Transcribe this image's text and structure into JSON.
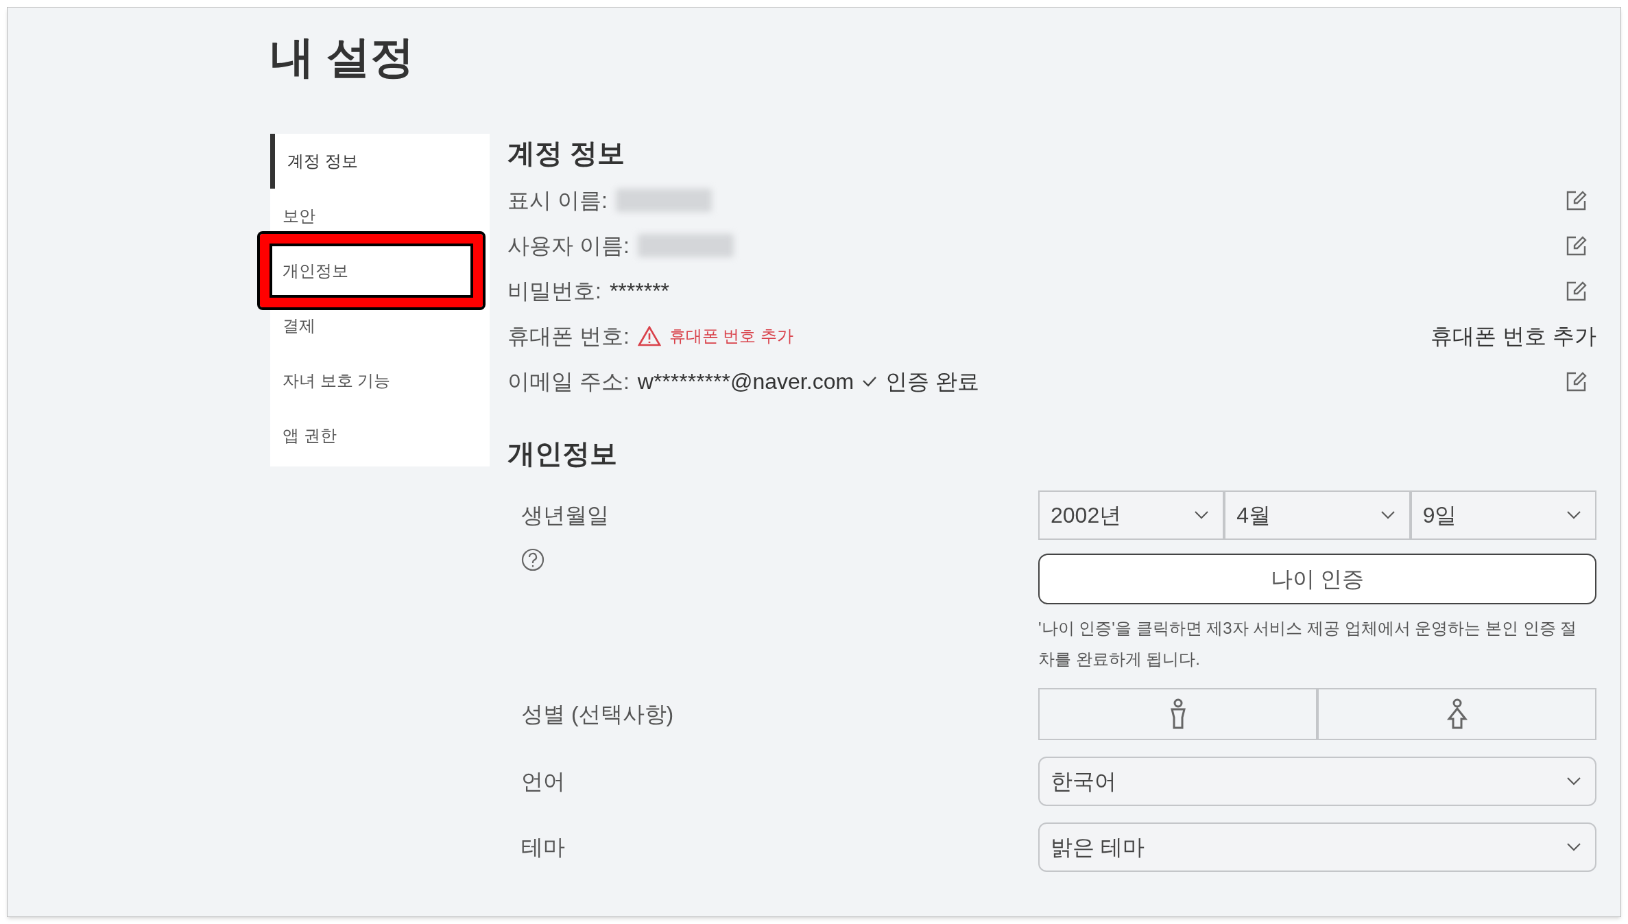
{
  "page": {
    "title": "내 설정"
  },
  "sidebar": {
    "items": [
      {
        "label": "계정 정보",
        "selected": true,
        "highlighted": false
      },
      {
        "label": "보안",
        "selected": false,
        "highlighted": false
      },
      {
        "label": "개인정보",
        "selected": false,
        "highlighted": true
      },
      {
        "label": "결제",
        "selected": false,
        "highlighted": false
      },
      {
        "label": "자녀 보호 기능",
        "selected": false,
        "highlighted": false
      },
      {
        "label": "앱 권한",
        "selected": false,
        "highlighted": false
      }
    ]
  },
  "account_info": {
    "title": "계정 정보",
    "rows": [
      {
        "label": "표시 이름:",
        "kind": "redacted",
        "editable": true
      },
      {
        "label": "사용자 이름:",
        "kind": "redacted",
        "editable": true
      },
      {
        "label": "비밀번호:",
        "kind": "text",
        "value": "*******",
        "editable": true
      },
      {
        "label": "휴대폰 번호:",
        "kind": "warning",
        "value": "휴대폰 번호 추가",
        "action": "휴대폰 번호 추가",
        "editable": false
      },
      {
        "label": "이메일 주소:",
        "kind": "verified",
        "value": "w*********@naver.com",
        "status": "인증 완료",
        "editable": true
      }
    ]
  },
  "personal_info": {
    "title": "개인정보",
    "birth_date": {
      "label": "생년월일",
      "selects": [
        "2002년",
        "4월",
        "9일"
      ]
    },
    "age_button": "나이 인증",
    "age_note": "'나이 인증'을 클릭하면 제3자 서비스 제공 업체에서 운영하는 본인 인증 절차를 완료하게 됩니다.",
    "gender": {
      "label": "성별 (선택사항)",
      "options": [
        {
          "kind": "male"
        },
        {
          "kind": "female"
        }
      ]
    },
    "language": {
      "label": "언어",
      "value": "한국어"
    },
    "theme": {
      "label": "테마",
      "value": "밝은 테마"
    }
  }
}
